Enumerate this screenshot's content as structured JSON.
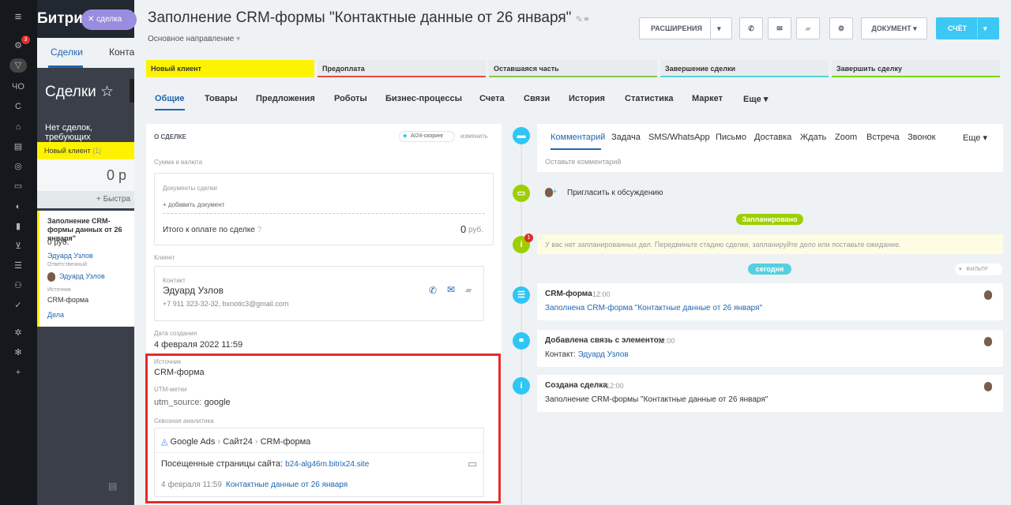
{
  "left_sidebar": {
    "badge": "3",
    "items": [
      "ЧО",
      "С"
    ]
  },
  "bg_app": {
    "brand": "Битри",
    "deal_pill": "сделка",
    "tab_deals": "Сделки",
    "tab_contacts": "Конта",
    "title": "Сделки ☆",
    "hint": "Нет сделок, требующих",
    "column": {
      "label": "Новый клиент",
      "count": "(1)",
      "sum": "0 р",
      "fast_add": "+ Быстра"
    },
    "card": {
      "title": "Заполнение CRM-формы данных от 26 января\"",
      "price": "0 руб.",
      "contact": "Эдуард Узлов",
      "resp_label": "Ответственный",
      "resp": "Эдуард Узлов",
      "source_label": "Источник",
      "source": "CRM-форма",
      "tasks": "Дела"
    }
  },
  "header": {
    "title": "Заполнение CRM-формы \"Контактные данные от 26 января\"",
    "subtitle": "Основное направление",
    "ext_button": "РАСШИРЕНИЯ",
    "doc_button": "ДОКУМЕНТ",
    "invoice_button": "СЧЁТ"
  },
  "stages": [
    {
      "label": "Новый клиент",
      "color": "#fdf300"
    },
    {
      "label": "Предоплата",
      "color": "#e74c3c"
    },
    {
      "label": "Оставшаяся часть",
      "color": "#8bc34a"
    },
    {
      "label": "Завершение сделки",
      "color": "#55d0e0"
    },
    {
      "label": "Завершить сделку",
      "color": "#7bd500"
    }
  ],
  "tabs": [
    "Общие",
    "Товары",
    "Предложения",
    "Роботы",
    "Бизнес-процессы",
    "Счета",
    "Связи",
    "История",
    "Статистика",
    "Маркет",
    "Еще"
  ],
  "about": {
    "heading": "О СДЕЛКЕ",
    "ai_scoring": "AI24-скоринг",
    "change": "изменить",
    "sum_label": "Сумма и валюта",
    "docs_label": "Документы сделки",
    "add_doc": "+ добавить документ",
    "total_label": "Итого к оплате по сделке",
    "total_value": "0",
    "total_currency": "руб.",
    "client_label": "Клиент",
    "contact_label": "Контакт",
    "contact_name": "Эдуард Узлов",
    "contact_info": "+7 911 323-32-32, bxnotic3@gmail.com",
    "created_label": "Дата создания",
    "created_value": "4 февраля 2022 11:59",
    "source_label": "Источник",
    "source_value": "CRM-форма",
    "utm_label": "UTM-метки",
    "utm_key": "utm_source:",
    "utm_value": "google",
    "analytics_label": "Сквозная аналитика",
    "path": [
      "Google Ads",
      "Сайт24",
      "CRM-форма"
    ],
    "visited_label": "Посещенные страницы сайта:",
    "visited_link": "b24-alg46m.bitrix24.site",
    "visit_time": "4 февраля 11:59",
    "visit_page": "Контактные данные от 26 января"
  },
  "timeline": {
    "tabs": [
      "Комментарий",
      "Задача",
      "SMS/WhatsApp",
      "Письмо",
      "Доставка",
      "Ждать",
      "Zoom",
      "Встреча",
      "Звонок",
      "Еще"
    ],
    "comment_placeholder": "Оставьте комментарий",
    "invite": "Пригласить к обсуждению",
    "planned": "Запланировано",
    "empty_note": "У вас нет запланированных дел. Передвиньте стадию сделки, запланируйте дело или поставьте ожидание.",
    "today": "сегодня",
    "filter": "ФИЛЬТР",
    "warn_badge": "1",
    "events": [
      {
        "title": "CRM-форма",
        "time": "12:00",
        "text": "Заполнена CRM-форма \"Контактные данные от 26 января\""
      },
      {
        "title": "Добавлена связь с элементом",
        "time": "12:00",
        "text_label": "Контакт:",
        "text_link": "Эдуард Узлов"
      },
      {
        "title": "Создана сделка",
        "time": "12:00",
        "text": "Заполнение CRM-формы \"Контактные данные от 26 января\""
      }
    ]
  }
}
